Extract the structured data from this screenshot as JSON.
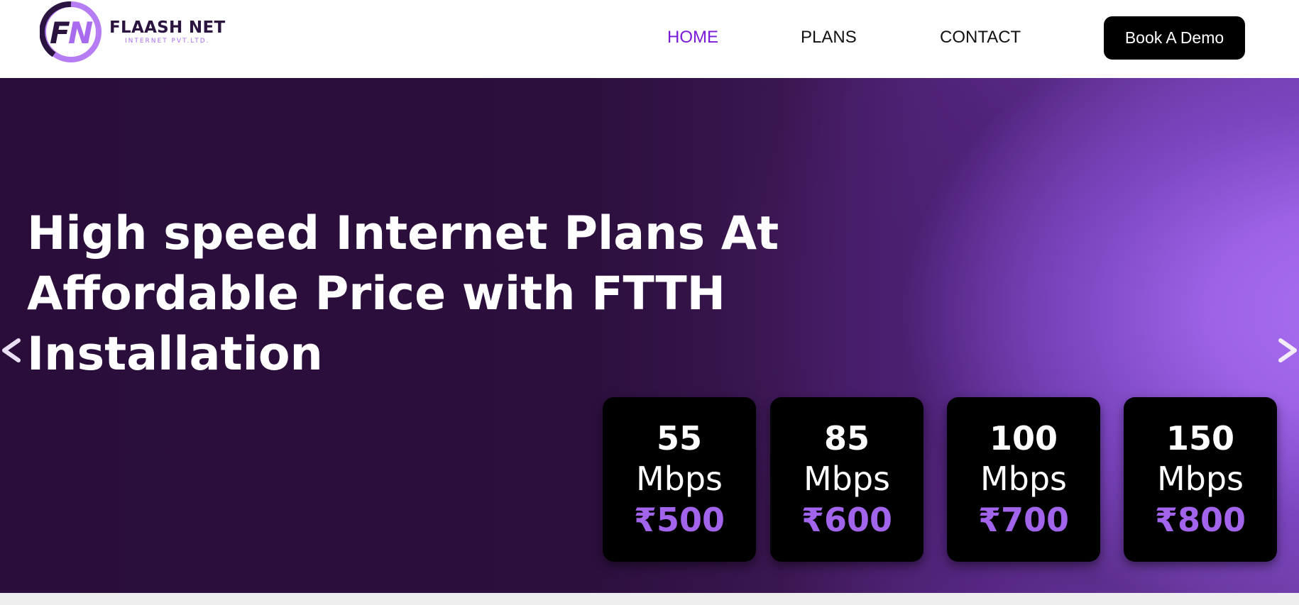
{
  "brand": {
    "name": "FLAASH NET",
    "subtitle": "INTERNET PVT.LTD.",
    "logo_letters": "FN",
    "colors": {
      "purple": "#a86bf0",
      "dark": "#2b1540"
    }
  },
  "nav": {
    "items": [
      {
        "label": "HOME",
        "active": true
      },
      {
        "label": "PLANS",
        "active": false
      },
      {
        "label": "CONTACT",
        "active": false
      }
    ],
    "cta_label": "Book A Demo",
    "active_color": "#7a1bd8"
  },
  "hero": {
    "title": "High speed Internet Plans At Affordable Price with FTTH Installation",
    "prev_icon": "chevron-left-icon",
    "next_icon": "chevron-right-icon",
    "plans": [
      {
        "speed": "55",
        "unit": "Mbps",
        "price": "₹500"
      },
      {
        "speed": "85",
        "unit": "Mbps",
        "price": "₹600"
      },
      {
        "speed": "100",
        "unit": "Mbps",
        "price": "₹700"
      },
      {
        "speed": "150",
        "unit": "Mbps",
        "price": "₹800"
      }
    ],
    "price_color": "#a364ec"
  }
}
